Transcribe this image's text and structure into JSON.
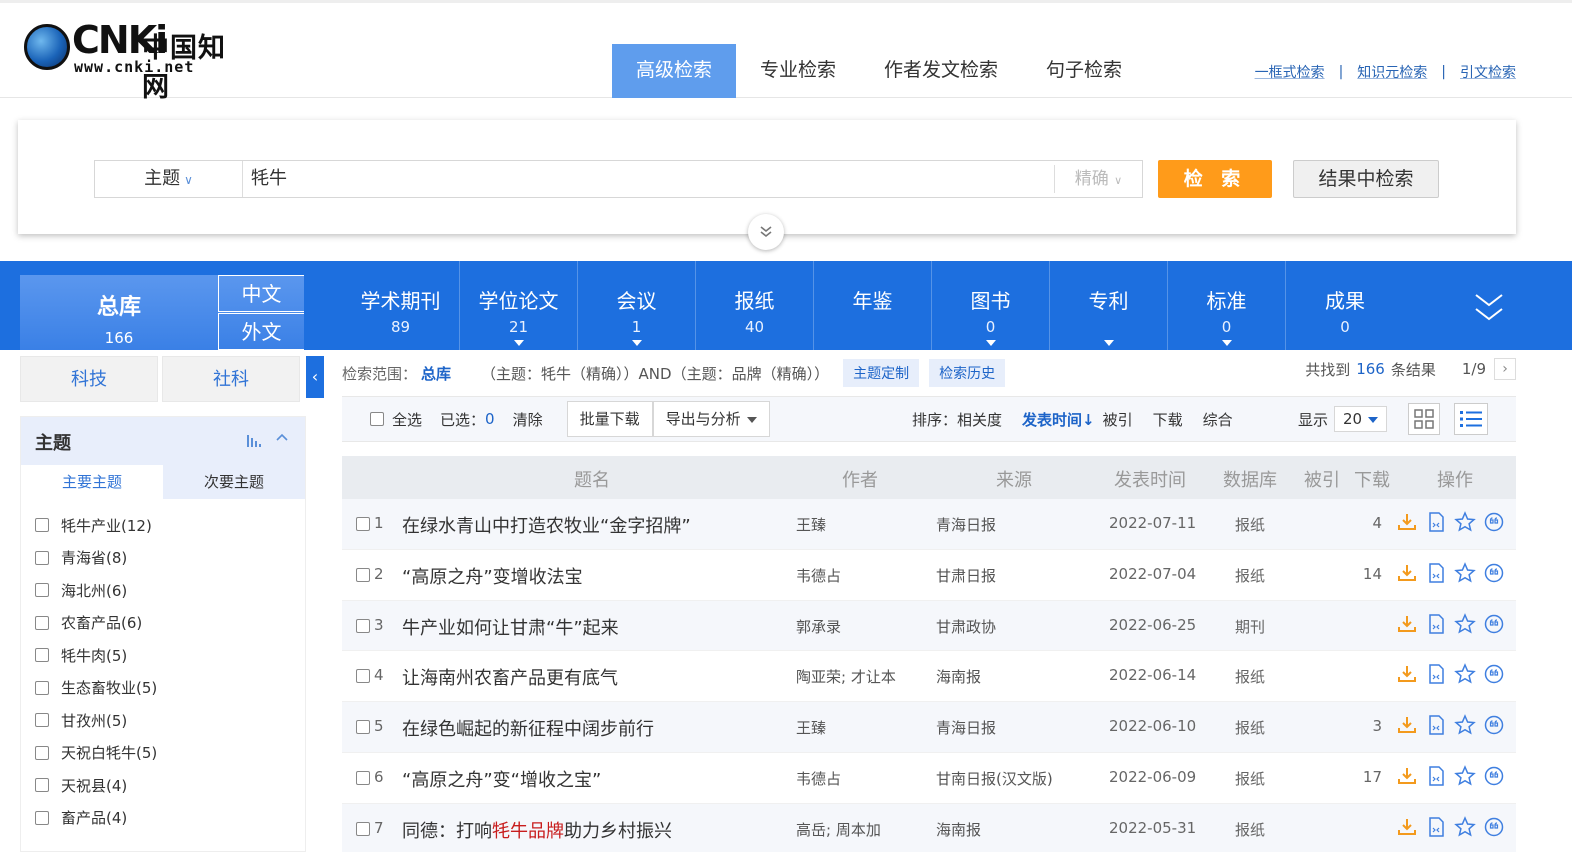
{
  "header": {
    "logo_brand": "CNKi",
    "logo_cn": "中国知网",
    "logo_url": "www.cnki.net",
    "tabs": [
      {
        "label": "高级检索",
        "active": true
      },
      {
        "label": "专业检索",
        "active": false
      },
      {
        "label": "作者发文检索",
        "active": false
      },
      {
        "label": "句子检索",
        "active": false
      }
    ],
    "links": [
      "一框式检索",
      "知识元检索",
      "引文检索"
    ]
  },
  "search": {
    "field": "主题",
    "query": "牦牛",
    "match": "精确",
    "search_btn": "检 索",
    "result_search_btn": "结果中检索"
  },
  "dbnav": {
    "all_label": "总库",
    "all_count": "166",
    "lang_zh": "中文",
    "lang_en": "外文",
    "items": [
      {
        "name": "学术期刊",
        "count": "89",
        "arrow": false
      },
      {
        "name": "学位论文",
        "count": "21",
        "arrow": true
      },
      {
        "name": "会议",
        "count": "1",
        "arrow": true
      },
      {
        "name": "报纸",
        "count": "40",
        "arrow": false
      },
      {
        "name": "年鉴",
        "count": "",
        "arrow": false
      },
      {
        "name": "图书",
        "count": "0",
        "arrow": true
      },
      {
        "name": "专利",
        "count": "",
        "arrow": true
      },
      {
        "name": "标准",
        "count": "0",
        "arrow": true
      },
      {
        "name": "成果",
        "count": "0",
        "arrow": false
      }
    ]
  },
  "sidebar": {
    "tabs": [
      "科技",
      "社科"
    ],
    "facet_title": "主题",
    "sub_tabs": [
      "主要主题",
      "次要主题"
    ],
    "facets": [
      "牦牛产业(12)",
      "青海省(8)",
      "海北州(6)",
      "农畜产品(6)",
      "牦牛肉(5)",
      "生态畜牧业(5)",
      "甘孜州(5)",
      "天祝白牦牛(5)",
      "天祝县(4)",
      "畜产品(4)"
    ]
  },
  "scope": {
    "label": "检索范围：",
    "db": "总库",
    "expression": "（主题：牦牛（精确））AND（主题：品牌（精确））",
    "btn_custom": "主题定制",
    "btn_history": "检索历史",
    "found_prefix": "共找到",
    "found_count": "166",
    "found_suffix": "条结果",
    "page": "1/9"
  },
  "toolbar": {
    "select_all": "全选",
    "selected_label": "已选：",
    "selected_count": "0",
    "clear": "清除",
    "batch_download": "批量下载",
    "export": "导出与分析",
    "sort_label": "排序：",
    "sort_options": [
      "相关度",
      "发表时间↓",
      "被引",
      "下载",
      "综合"
    ],
    "display_label": "显示",
    "page_size": "20"
  },
  "table": {
    "headers": [
      "题名",
      "作者",
      "来源",
      "发表时间",
      "数据库",
      "被引",
      "下载",
      "操作"
    ],
    "rows": [
      {
        "idx": "1",
        "title": "在绿水青山中打造农牧业“金字招牌”",
        "author": "王臻",
        "source": "青海日报",
        "date": "2022-07-11",
        "db": "报纸",
        "cited": "",
        "downloads": "4"
      },
      {
        "idx": "2",
        "title": "“高原之舟”变增收法宝",
        "author": "韦德占",
        "source": "甘肃日报",
        "date": "2022-07-04",
        "db": "报纸",
        "cited": "",
        "downloads": "14"
      },
      {
        "idx": "3",
        "title": "牛产业如何让甘肃“牛”起来",
        "author": "郭承录",
        "source": "甘肃政协",
        "date": "2022-06-25",
        "db": "期刊",
        "cited": "",
        "downloads": ""
      },
      {
        "idx": "4",
        "title": "让海南州农畜产品更有底气",
        "author": "陶亚荣; 才让本",
        "source": "海南报",
        "date": "2022-06-14",
        "db": "报纸",
        "cited": "",
        "downloads": ""
      },
      {
        "idx": "5",
        "title": "在绿色崛起的新征程中阔步前行",
        "author": "王臻",
        "source": "青海日报",
        "date": "2022-06-10",
        "db": "报纸",
        "cited": "",
        "downloads": "3"
      },
      {
        "idx": "6",
        "title": "“高原之舟”变“增收之宝”",
        "author": "韦德占",
        "source": "甘南日报(汉文版)",
        "date": "2022-06-09",
        "db": "报纸",
        "cited": "",
        "downloads": "17"
      },
      {
        "idx": "7",
        "title_pre": "同德：打响",
        "title_hl": "牦牛品牌",
        "title_post": "助力乡村振兴",
        "author": "高岳; 周本加",
        "source": "海南报",
        "date": "2022-05-31",
        "db": "报纸",
        "cited": "",
        "downloads": ""
      }
    ]
  },
  "colors": {
    "primary": "#1d6fdf",
    "accent": "#ff9b1a",
    "link": "#1d64c8",
    "highlight": "#c81d1d"
  }
}
